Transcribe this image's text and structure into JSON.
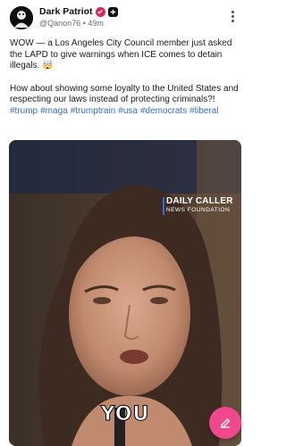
{
  "post": {
    "author": "Dark Patriot",
    "handle": "@Qanon76",
    "separator": "•",
    "time": "49m",
    "text_line1": "WOW — a Los Angeles City Council member just asked the LAPD to give warnings when ICE comes to detain illegals. 🤯",
    "text_line2": "How about showing some loyalty to the United States and respecting our laws instead of protecting criminals?!",
    "hashtags": [
      "#trump",
      "#maga",
      "#trumptrain",
      "#usa",
      "#democrats",
      "#liberal"
    ]
  },
  "video": {
    "logo_title": "DAILY CALLER",
    "logo_subtitle": "NEWS FOUNDATION",
    "caption": "YOU"
  },
  "icons": {
    "verified": "verified-badge-icon",
    "plus": "plus-badge-icon",
    "menu": "more-vertical-icon",
    "compose": "compose-icon"
  },
  "colors": {
    "verified": "#e0245e",
    "hashtag": "#3a6bc9",
    "fab": "#f0488c"
  }
}
